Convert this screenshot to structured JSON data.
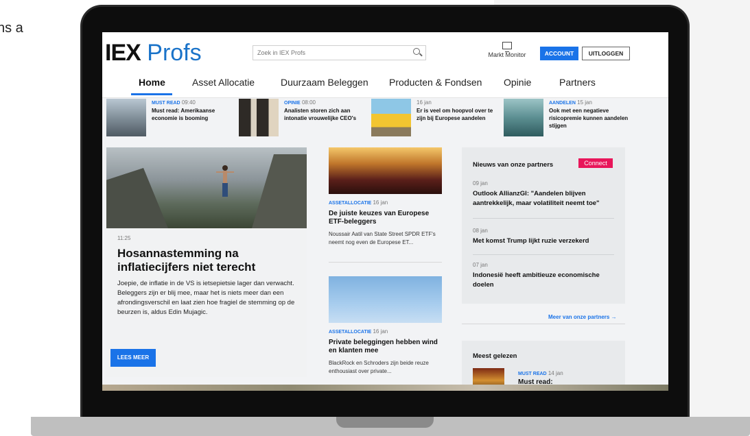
{
  "page_cut_text": "ns a",
  "header": {
    "logo_iex": "IEX",
    "logo_profs": "Profs",
    "search_placeholder": "Zoek in IEX Profs",
    "markt_monitor": "Markt Monitor",
    "account_label": "ACCOUNT",
    "logout_label": "UITLOGGEN"
  },
  "nav": {
    "items": [
      {
        "label": "Home"
      },
      {
        "label": "Asset Allocatie"
      },
      {
        "label": "Duurzaam Beleggen"
      },
      {
        "label": "Producten & Fondsen"
      },
      {
        "label": "Opinie"
      },
      {
        "label": "Partners"
      }
    ]
  },
  "strip": [
    {
      "tag": "MUST READ",
      "time": "09:40",
      "title": "Must read: Amerikaanse economie is booming"
    },
    {
      "tag": "OPINIE",
      "time": "08:00",
      "title": "Analisten storen zich aan intonatie vrouwelijke CEO's"
    },
    {
      "tag": "",
      "time": "16 jan",
      "title": "Er is veel om hoopvol over te zijn bij Europese aandelen"
    },
    {
      "tag": "AANDELEN",
      "time": "15 jan",
      "title": "Ook met een negatieve risicopremie kunnen aandelen stijgen"
    }
  ],
  "hero": {
    "time": "11:25",
    "title": "Hosannastemming na inflatiecijfers niet terecht",
    "body": "Joepie, de inflatie in de VS is ietsepietsie lager dan verwacht. Beleggers zijn er blij mee, maar het is niets meer dan een afrondingsverschil en laat zien hoe fragiel de stemming op de beurzen is, aldus Edin Mujagic.",
    "button": "LEES MEER"
  },
  "cards": [
    {
      "tag": "ASSETALLOCATIE",
      "date": "16 jan",
      "title": "De juiste keuzes van Europese ETF-beleggers",
      "body": "Noussair Aatil van State Street SPDR ETF's neemt nog even de Europese ET..."
    },
    {
      "tag": "ASSETALLOCATIE",
      "date": "16 jan",
      "title": "Private beleggingen hebben wind en klanten mee",
      "body": "BlackRock en Schroders zijn beide reuze enthousiast over private..."
    }
  ],
  "partners": {
    "title": "Nieuws van onze partners",
    "connect": "Connect",
    "items": [
      {
        "date": "09 jan",
        "title": "Outlook AllianzGI: \"Aandelen blijven aantrekkelijk, maar volatiliteit neemt toe\""
      },
      {
        "date": "08 jan",
        "title": "Met komst Trump lijkt ruzie verzekerd"
      },
      {
        "date": "07 jan",
        "title": "Indonesië heeft ambitieuze economische doelen"
      }
    ],
    "more": "Meer van onze partners"
  },
  "meest": {
    "title": "Meest gelezen",
    "tag": "MUST READ",
    "date": "14 jan",
    "item_title": "Must read:"
  },
  "colors": {
    "accent": "#1a73e8",
    "connect": "#e8165a"
  }
}
